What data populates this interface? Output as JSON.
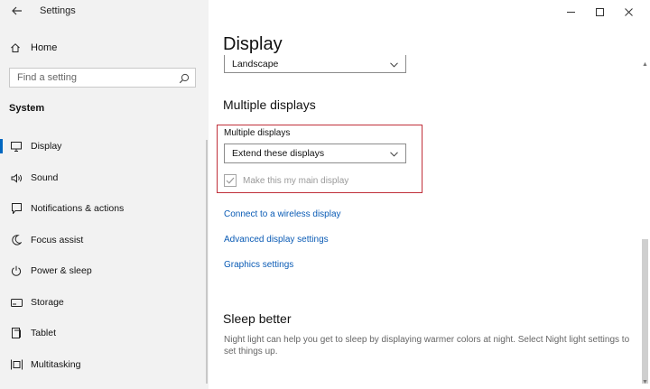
{
  "window": {
    "title": "Settings"
  },
  "sidebar": {
    "home_label": "Home",
    "search_placeholder": "Find a setting",
    "section_label": "System",
    "items": [
      {
        "label": "Display",
        "icon": "monitor-icon",
        "active": true
      },
      {
        "label": "Sound",
        "icon": "speaker-icon"
      },
      {
        "label": "Notifications & actions",
        "icon": "notification-icon"
      },
      {
        "label": "Focus assist",
        "icon": "moon-icon"
      },
      {
        "label": "Power & sleep",
        "icon": "power-icon"
      },
      {
        "label": "Storage",
        "icon": "storage-icon"
      },
      {
        "label": "Tablet",
        "icon": "tablet-icon"
      },
      {
        "label": "Multitasking",
        "icon": "multitasking-icon"
      }
    ]
  },
  "main": {
    "title": "Display",
    "orientation_value": "Landscape",
    "multiple_displays_heading": "Multiple displays",
    "multiple_displays_label": "Multiple displays",
    "multiple_displays_value": "Extend these displays",
    "main_display_checkbox": {
      "label": "Make this my main display",
      "checked": true,
      "disabled": true
    },
    "links": [
      "Connect to a wireless display",
      "Advanced display settings",
      "Graphics settings"
    ],
    "sleep_heading": "Sleep better",
    "sleep_text": "Night light can help you get to sleep by displaying warmer colors at night. Select Night light settings to set things up."
  },
  "colors": {
    "accent": "#0067c0",
    "link": "#0a5bb5",
    "highlight_border": "#c0303a",
    "sidebar_bg": "#f2f2f2"
  }
}
